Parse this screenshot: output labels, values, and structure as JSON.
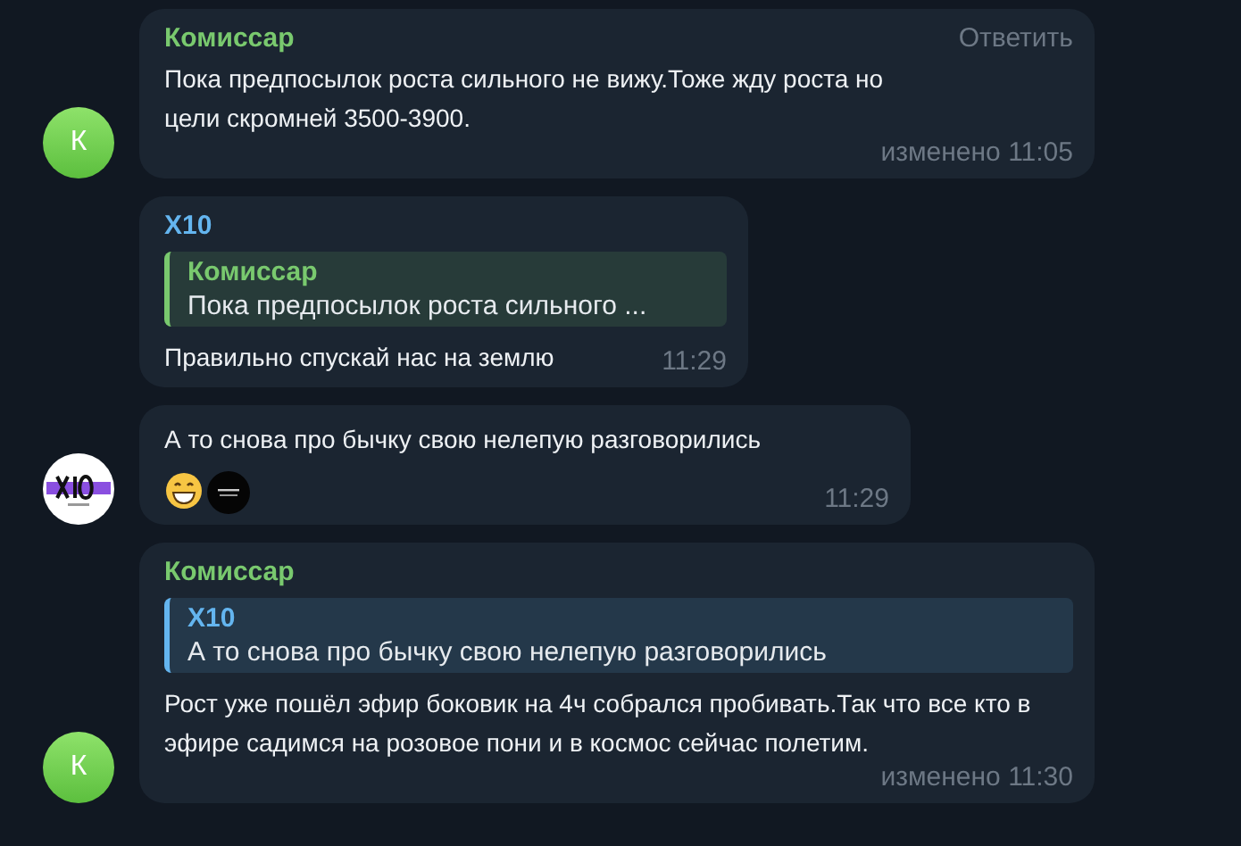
{
  "messages": [
    {
      "sender": {
        "name": "Комиссар",
        "color": "#79c96e"
      },
      "avatar": {
        "kind": "letter",
        "letter": "К"
      },
      "reply_action": "Ответить",
      "text": "Пока предпосылок роста сильного не вижу.Тоже жду роста но цели скромней 3500-3900.",
      "meta": "изменено 11:05"
    },
    {
      "sender": {
        "name": "X10",
        "color": "#64b5ef"
      },
      "quote": {
        "author": "Комиссар",
        "text": "Пока предпосылок роста сильного ...",
        "color": "#79c96e"
      },
      "text": "Правильно спускай нас на землю",
      "meta": "11:29"
    },
    {
      "avatar": {
        "kind": "logo"
      },
      "text": "А то снова про бычку свою нелепую разговорились",
      "reactions": [
        {
          "kind": "grin"
        },
        {
          "kind": "custom"
        }
      ],
      "meta": "11:29"
    },
    {
      "sender": {
        "name": "Комиссар",
        "color": "#79c96e"
      },
      "avatar": {
        "kind": "letter",
        "letter": "К"
      },
      "quote": {
        "author": "X10",
        "text": "А то снова про бычку свою нелепую разговорились",
        "color": "#64b5ef"
      },
      "text": "Рост уже пошёл эфир боковик на 4ч собрался пробивать.Так что все кто в эфире садимся на розовое пони и в космос сейчас полетим.",
      "meta": "изменено 11:30"
    }
  ]
}
